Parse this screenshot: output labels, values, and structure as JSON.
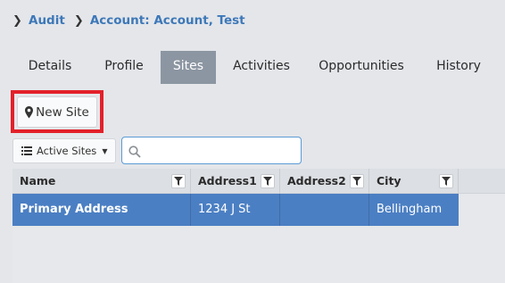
{
  "breadcrumb": {
    "items": [
      "Audit",
      "Account: Account, Test"
    ]
  },
  "tabs": [
    {
      "label": "Details",
      "active": false
    },
    {
      "label": "Profile",
      "active": false
    },
    {
      "label": "Sites",
      "active": true
    },
    {
      "label": "Activities",
      "active": false
    },
    {
      "label": "Opportunities",
      "active": false
    },
    {
      "label": "History",
      "active": false
    }
  ],
  "toolbar": {
    "new_site_label": "New Site",
    "filter_view_label": "Active Sites",
    "search_value": "",
    "search_placeholder": ""
  },
  "grid": {
    "columns": [
      "Name",
      "Address1",
      "Address2",
      "City"
    ],
    "rows": [
      {
        "name": "Primary Address",
        "address1": "1234 J St",
        "address2": "",
        "city": "Bellingham",
        "selected": true
      }
    ]
  },
  "colors": {
    "link": "#3d78b8",
    "active_tab": "#8c96a2",
    "selected_row": "#4b7fc3",
    "highlight_box": "#e3202a"
  }
}
